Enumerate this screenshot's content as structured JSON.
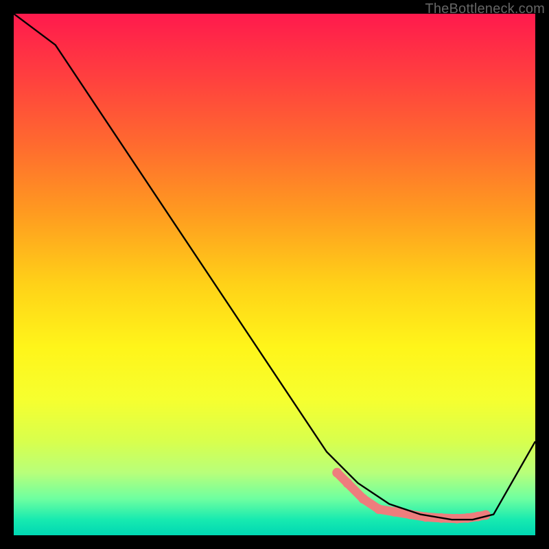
{
  "watermark": {
    "text": "TheBottleneck.com"
  },
  "chart_data": {
    "type": "line",
    "title": "",
    "xlabel": "",
    "ylabel": "",
    "xlim": [
      0,
      100
    ],
    "ylim": [
      0,
      100
    ],
    "series": [
      {
        "name": "curve",
        "x": [
          0,
          8,
          60,
          66,
          72,
          78,
          84,
          88,
          92,
          100
        ],
        "y": [
          100,
          94,
          16,
          10,
          6,
          4,
          3,
          3,
          4,
          18
        ]
      }
    ],
    "markers": {
      "name": "highlight-dots",
      "x": [
        62,
        64,
        67,
        70,
        73,
        76,
        79,
        82,
        85,
        87,
        89,
        90.5
      ],
      "y": [
        12,
        10,
        7,
        5,
        4.5,
        4,
        3.5,
        3.3,
        3.2,
        3.3,
        3.6,
        3.9
      ]
    },
    "colors": {
      "curve": "#000000",
      "markers": "#ee7d7d"
    }
  }
}
